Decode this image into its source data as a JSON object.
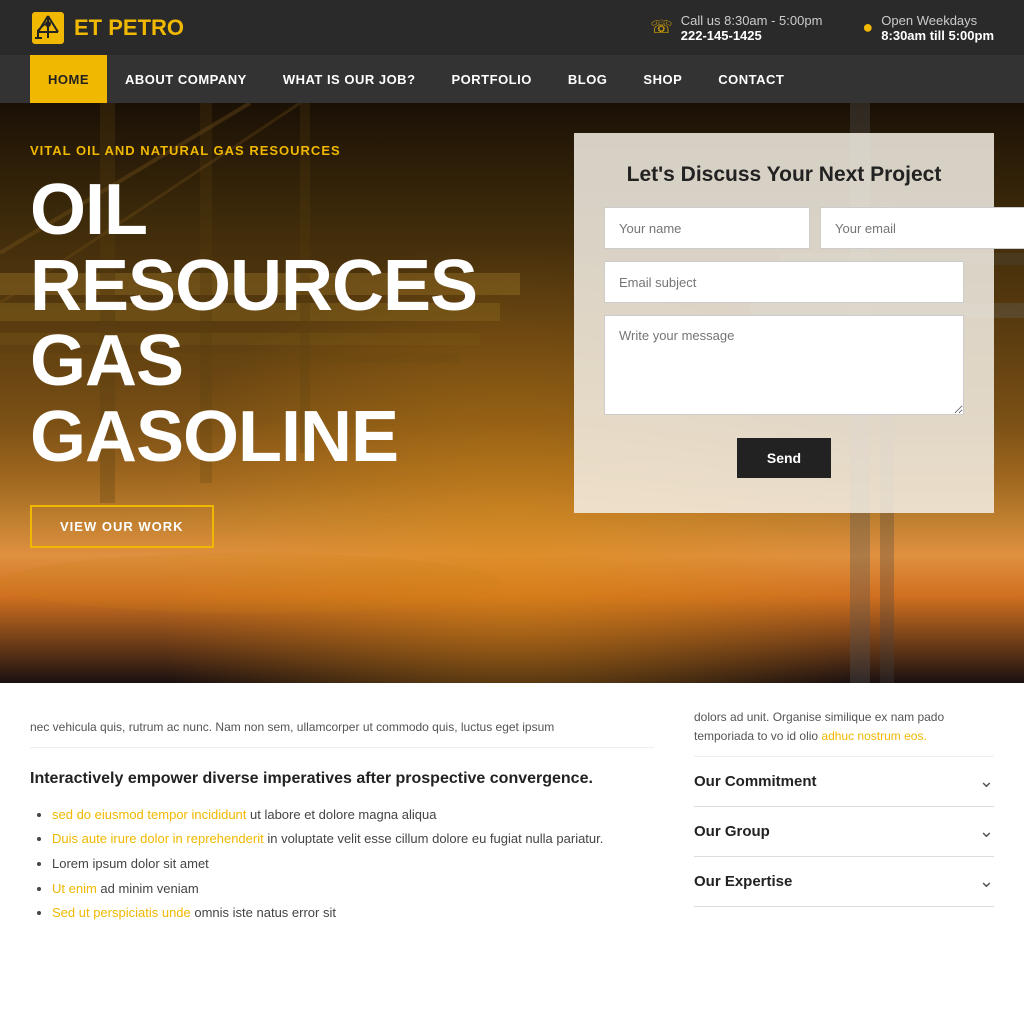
{
  "topbar": {
    "logo_prefix": "ET ",
    "logo_highlight": "PETRO",
    "call_label": "Call us 8:30am - 5:00pm",
    "phone": "222-145-1425",
    "hours_label": "Open Weekdays",
    "hours": "8:30am till 5:00pm"
  },
  "nav": {
    "items": [
      {
        "label": "HOME",
        "active": true
      },
      {
        "label": "ABOUT COMPANY",
        "active": false
      },
      {
        "label": "WHAT IS OUR JOB?",
        "active": false
      },
      {
        "label": "PORTFOLIO",
        "active": false
      },
      {
        "label": "BLOG",
        "active": false
      },
      {
        "label": "SHOP",
        "active": false
      },
      {
        "label": "CONTACT",
        "active": false
      }
    ]
  },
  "hero": {
    "subtitle": "VITAL OIL AND NATURAL GAS RESOURCES",
    "title_line1": "OIL",
    "title_line2": "RESOURCES",
    "title_line3": "GAS",
    "title_line4": "GASOLINE",
    "cta_label": "VIEW OUR WORK"
  },
  "contact_form": {
    "title": "Let's Discuss Your Next Project",
    "name_placeholder": "Your name",
    "email_placeholder": "Your email",
    "subject_placeholder": "Email subject",
    "message_placeholder": "Write your message",
    "send_label": "Send"
  },
  "bottom": {
    "scrolled_left": "nec vehicula quis, rutrum ac nunc. Nam non sem, ullamcorper ut commodo quis, luctus eget ipsum",
    "scrolled_right": "dolors ad unit. Organise similique ex nam pado temporiada to vo id olio adhuc nostrum eos.",
    "scrolled_link": "adhuc nostrum eos.",
    "section_heading": "Interactively empower diverse imperatives after prospective convergence.",
    "bullets": [
      {
        "text": "sed do eiusmod tempor incididunt",
        "link_text": "sed do eiusmod tempor incididunt",
        "rest": " ut labore et dolore magna aliqua"
      },
      {
        "text": "Duis aute irure dolor in reprehenderit",
        "link_text": "Duis aute irure dolor in reprehenderit",
        "rest": " in voluptate velit esse cillum dolore eu fugiat nulla pariatur."
      },
      {
        "text": "Lorem ipsum dolor sit amet",
        "link": false
      },
      {
        "text": "Ut enim ad minim veniam",
        "link_word": "Ut enim",
        "link": true
      },
      {
        "text": "Sed ut perspiciatis unde omnis iste natus error sit",
        "link_word": "Sed ut perspiciatis unde",
        "link": true
      }
    ],
    "accordion": [
      {
        "label": "Our Commitment"
      },
      {
        "label": "Our Group"
      },
      {
        "label": "Our Expertise"
      }
    ]
  }
}
